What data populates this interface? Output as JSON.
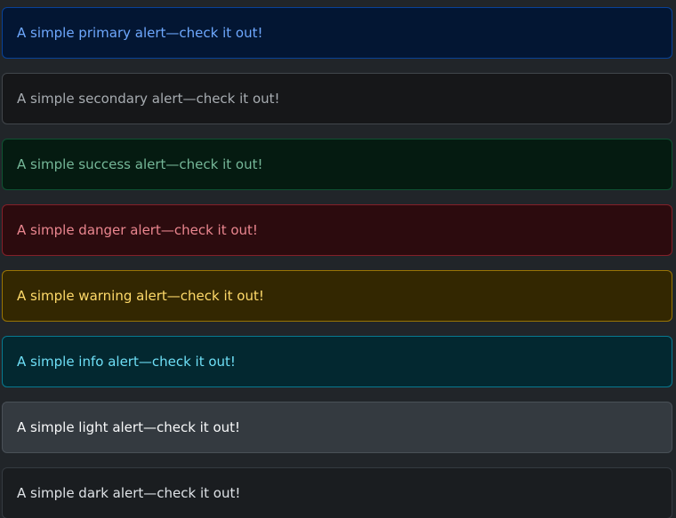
{
  "alerts": [
    {
      "variant": "primary",
      "text": "A simple primary alert—check it out!"
    },
    {
      "variant": "secondary",
      "text": "A simple secondary alert—check it out!"
    },
    {
      "variant": "success",
      "text": "A simple success alert—check it out!"
    },
    {
      "variant": "danger",
      "text": "A simple danger alert—check it out!"
    },
    {
      "variant": "warning",
      "text": "A simple warning alert—check it out!"
    },
    {
      "variant": "info",
      "text": "A simple info alert—check it out!"
    },
    {
      "variant": "light",
      "text": "A simple light alert—check it out!"
    },
    {
      "variant": "dark",
      "text": "A simple dark alert—check it out!"
    }
  ],
  "colors": {
    "page_background": "#212529",
    "primary": {
      "background": "#031633",
      "border": "#084298",
      "text": "#6ea8fe"
    },
    "secondary": {
      "background": "#161719",
      "border": "#41464b",
      "text": "#a7acb1"
    },
    "success": {
      "background": "#051b11",
      "border": "#0f5132",
      "text": "#75b798"
    },
    "danger": {
      "background": "#2c0b0e",
      "border": "#842029",
      "text": "#ea868f"
    },
    "warning": {
      "background": "#332701",
      "border": "#997404",
      "text": "#ffda6a"
    },
    "info": {
      "background": "#032830",
      "border": "#087990",
      "text": "#6edff6"
    },
    "light": {
      "background": "#343a40",
      "border": "#495057",
      "text": "#f8f9fa"
    },
    "dark": {
      "background": "#1a1d20",
      "border": "#343a40",
      "text": "#dee2e6"
    }
  }
}
